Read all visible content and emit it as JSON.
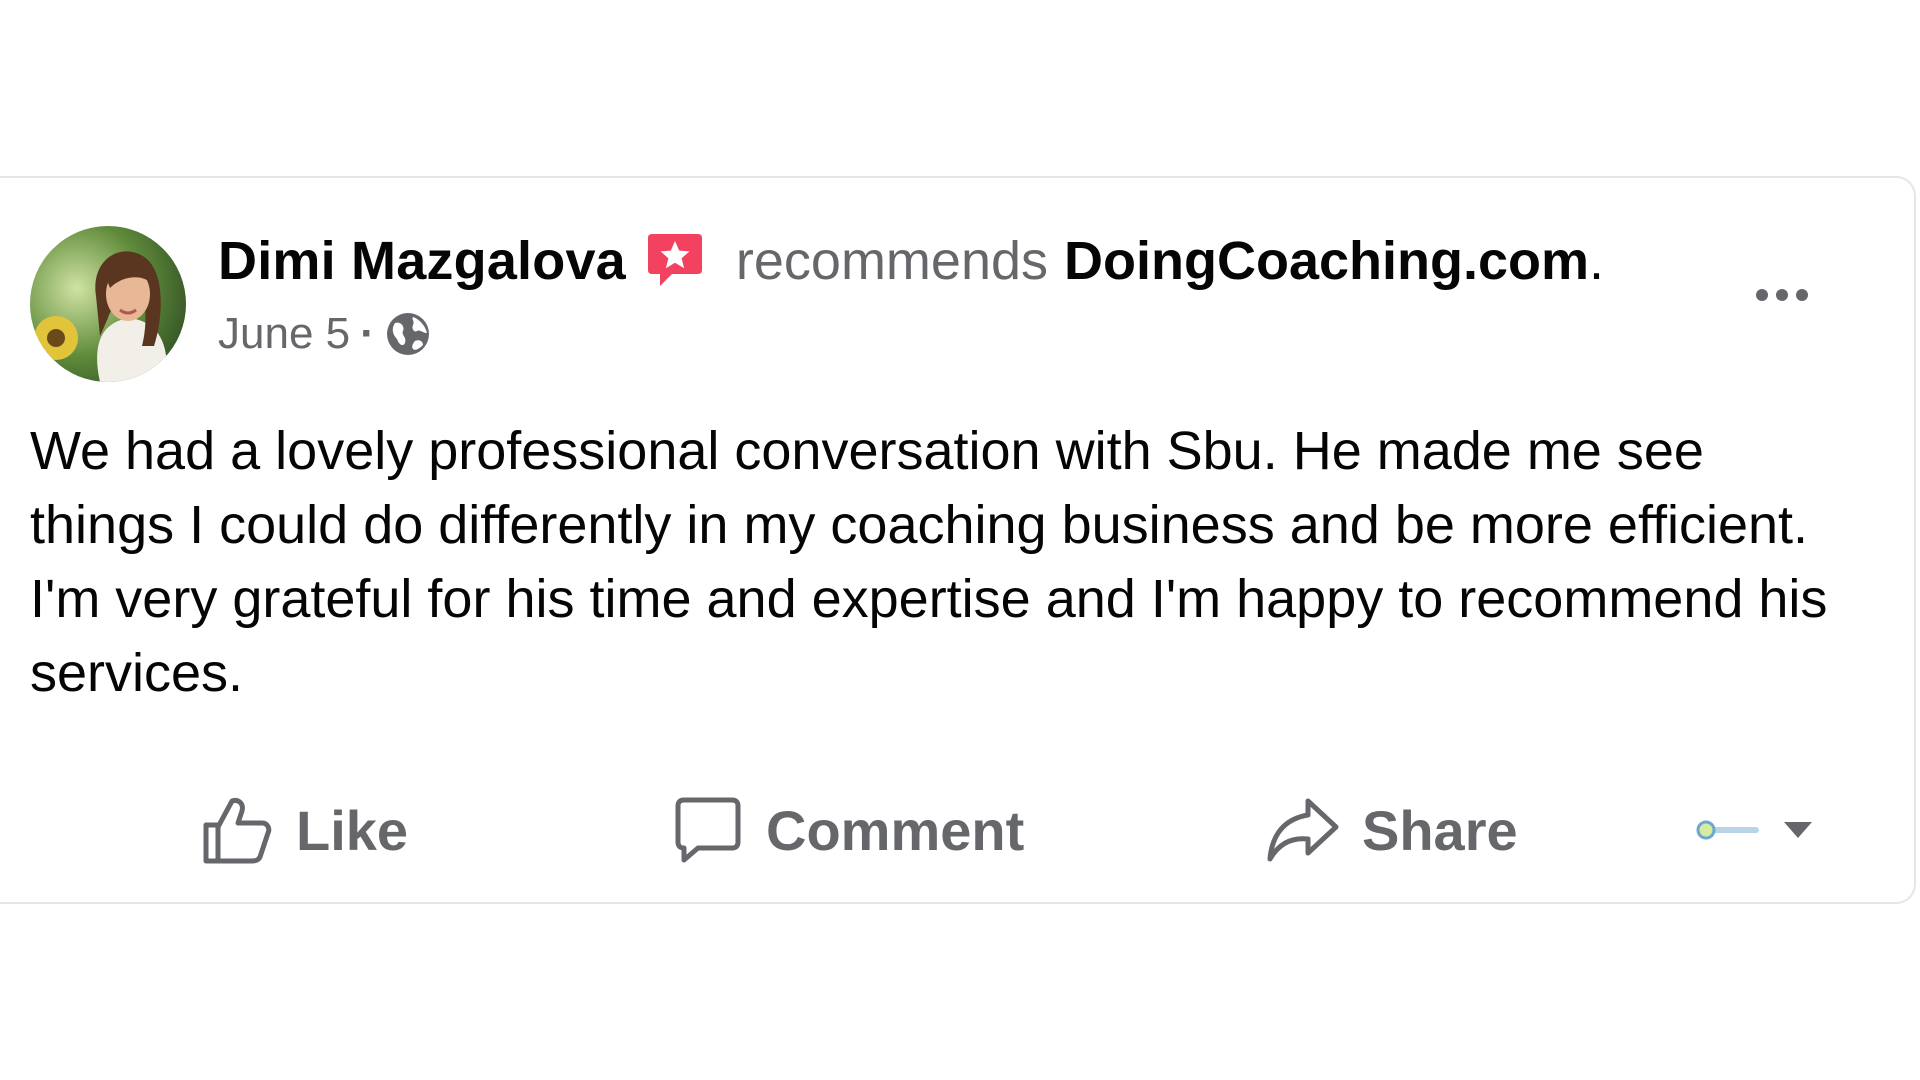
{
  "post": {
    "author": "Dimi Mazgalova",
    "action_text": "recommends",
    "page": "DoingCoaching.com",
    "page_suffix": ".",
    "date": "June 5",
    "separator": "·",
    "privacy_icon": "globe-icon",
    "badge_icon": "recommend-star-icon",
    "more_icon": "more-options-icon",
    "body": "We had a lovely professional conversation with Sbu. He made me see things I could do differently in my coaching business and be more efficient. I'm very grateful for his time and expertise and I'm happy to recommend his services."
  },
  "actions": {
    "like_label": "Like",
    "comment_label": "Comment",
    "share_label": "Share",
    "audience_icon": "audience-selector-icon"
  },
  "colors": {
    "text_primary": "#050505",
    "text_secondary": "#65676b",
    "badge": "#f3425f",
    "card_border": "#e4e6ea"
  }
}
